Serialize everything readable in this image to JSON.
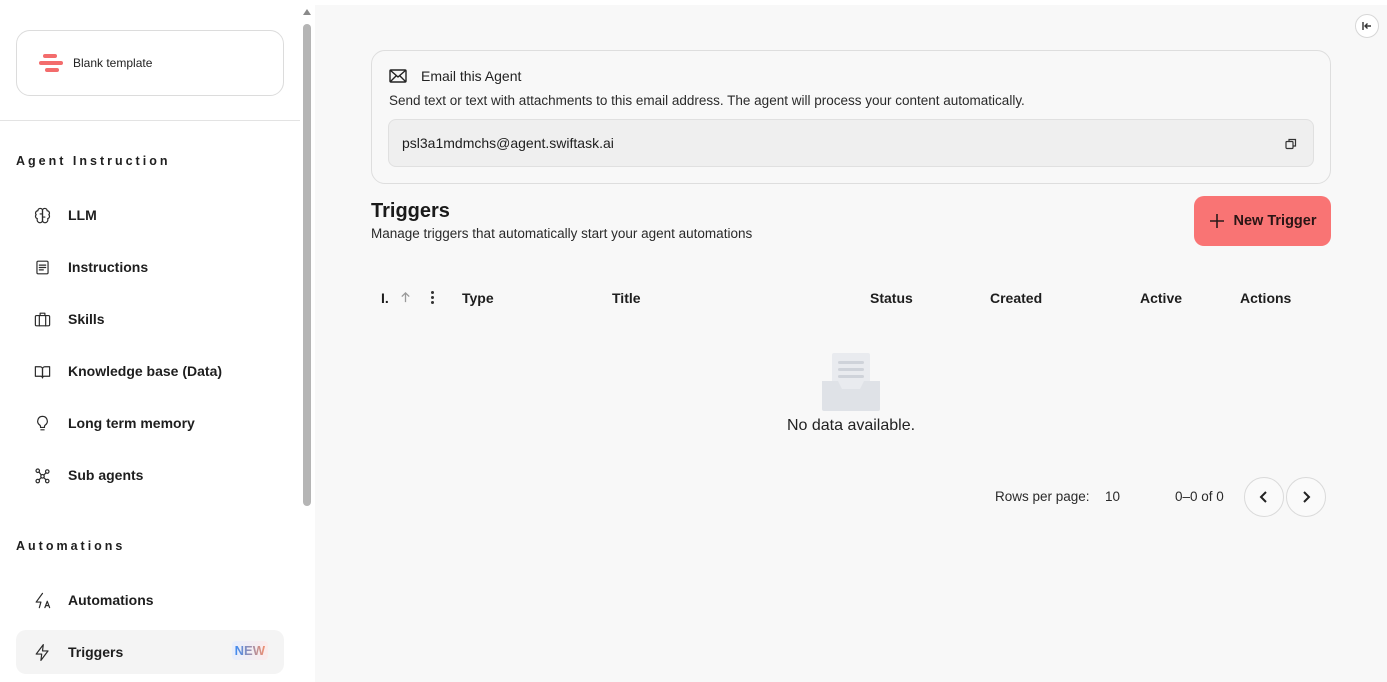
{
  "sidebar": {
    "template_label": "Blank template",
    "section_agent": "Agent Instruction",
    "agent_items": [
      {
        "label": "LLM",
        "icon": "brain-icon"
      },
      {
        "label": "Instructions",
        "icon": "document-icon"
      },
      {
        "label": "Skills",
        "icon": "briefcase-icon"
      },
      {
        "label": "Knowledge base (Data)",
        "icon": "book-open-icon"
      },
      {
        "label": "Long term memory",
        "icon": "lightbulb-icon"
      },
      {
        "label": "Sub agents",
        "icon": "network-icon"
      }
    ],
    "section_automations": "Automations",
    "automation_items": [
      {
        "label": "Automations",
        "icon": "sparkle-bolt-icon"
      },
      {
        "label": "Triggers",
        "icon": "bolt-icon",
        "badge": "NEW",
        "active": true
      }
    ]
  },
  "email": {
    "title": "Email this Agent",
    "description": "Send text or text with attachments to this email address. The agent will process your content automatically.",
    "address": "psl3a1mdmchs@agent.swiftask.ai"
  },
  "triggers": {
    "title": "Triggers",
    "description": "Manage triggers that automatically start your agent automations",
    "new_button": "New Trigger"
  },
  "table": {
    "columns": [
      "I.",
      "Type",
      "Title",
      "Status",
      "Created",
      "Active",
      "Actions"
    ],
    "empty_text": "No data available."
  },
  "pagination": {
    "rows_label": "Rows per page:",
    "rows_value": "10",
    "range": "0–0 of 0"
  },
  "colors": {
    "accent": "#f97474",
    "main_bg": "#f8f8f8"
  }
}
